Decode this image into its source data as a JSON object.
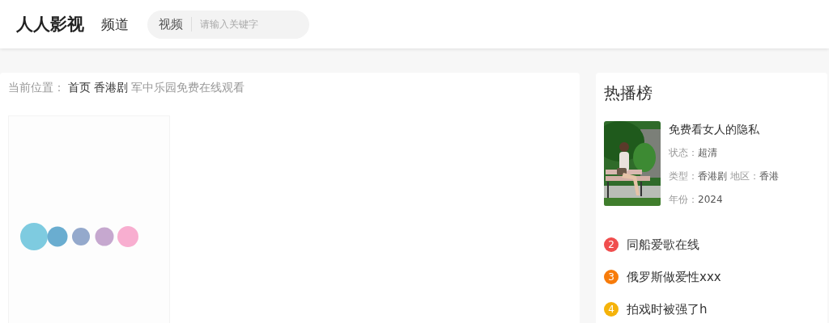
{
  "header": {
    "logo": "人人影视",
    "nav": "频道",
    "search": {
      "category": "视频",
      "placeholder": "请输入关键字"
    }
  },
  "breadcrumb": {
    "label": "当前位置：",
    "links": [
      "首页",
      "香港剧"
    ],
    "current": "军中乐园免费在线观看"
  },
  "hot": {
    "title": "热播榜",
    "top": {
      "kind": "picture",
      "title": "免费看女人的隐私",
      "lines": [
        [
          {
            "label": "状态：",
            "value": "超清"
          }
        ],
        [
          {
            "label": "类型：",
            "value": "香港剧"
          },
          {
            "label": "地区：",
            "value": "香港"
          }
        ],
        [
          {
            "label": "年份：",
            "value": "2024"
          }
        ]
      ]
    },
    "items": [
      {
        "rank": "2",
        "title": "同船爱歌在线",
        "color": "#f04e4e"
      },
      {
        "rank": "3",
        "title": "俄罗斯做爱性xxx",
        "color": "#f77b0a"
      },
      {
        "rank": "4",
        "title": "拍戏时被强了h",
        "color": "#f5b30a"
      }
    ]
  }
}
